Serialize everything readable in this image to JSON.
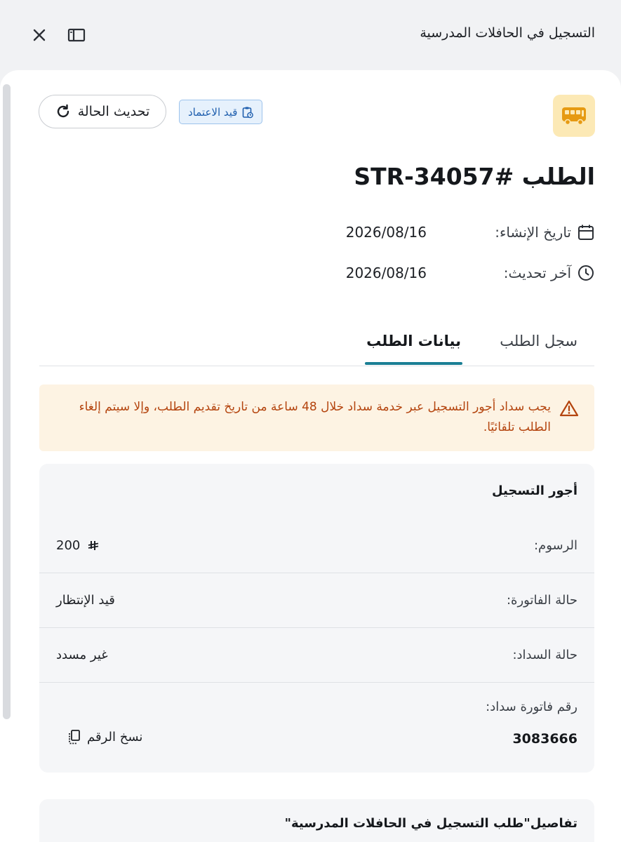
{
  "window": {
    "title": "التسجيل في الحافلات المدرسية"
  },
  "header": {
    "status_badge": "قيد الاعتماد",
    "refresh_label": "تحديث الحالة",
    "request_title": "الطلب #STR-34057"
  },
  "meta": {
    "created_label": "تاريخ الإنشاء:",
    "created_value": "2026/08/16",
    "updated_label": "آخر تحديث:",
    "updated_value": "2026/08/16"
  },
  "tabs": [
    {
      "label": "سجل الطلب",
      "active": false
    },
    {
      "label": "بيانات الطلب",
      "active": true
    }
  ],
  "warning": {
    "text": "يجب سداد أجور التسجيل عبر خدمة سداد خلال 48 ساعة من تاريخ تقديم الطلب، وإلا سيتم إلغاء الطلب تلقائيًا."
  },
  "fees_card": {
    "title": "أجور التسجيل",
    "fees_label": "الرسوم:",
    "fees_value": "200",
    "invoice_status_label": "حالة الفاتورة:",
    "invoice_status_value": "قيد الإنتظار",
    "payment_status_label": "حالة السداد:",
    "payment_status_value": "غير مسدد",
    "sadad_invoice_label": "رقم فاتورة سداد:",
    "sadad_invoice_value": "3083666",
    "copy_label": "نسخ الرقم"
  },
  "details_card": {
    "title": "تفاصيل\"طلب التسجيل في الحافلات المدرسية\""
  },
  "colors": {
    "accent": "#1a7f94",
    "warning_text": "#b4440e",
    "warning_bg": "#fdf3e3",
    "badge_text": "#1f5fae",
    "badge_bg": "#e6f1fc",
    "bus_icon_bg": "#fce9b5",
    "bus_icon": "#e69a12"
  },
  "icons": {
    "close": "close-icon",
    "sidebar": "sidebar-toggle-icon",
    "bus": "bus-icon",
    "refresh": "refresh-icon",
    "badge": "clipboard-clock-icon",
    "calendar": "calendar-icon",
    "clock": "clock-icon",
    "warning": "warning-icon",
    "currency": "riyal-icon",
    "copy": "copy-icon"
  }
}
